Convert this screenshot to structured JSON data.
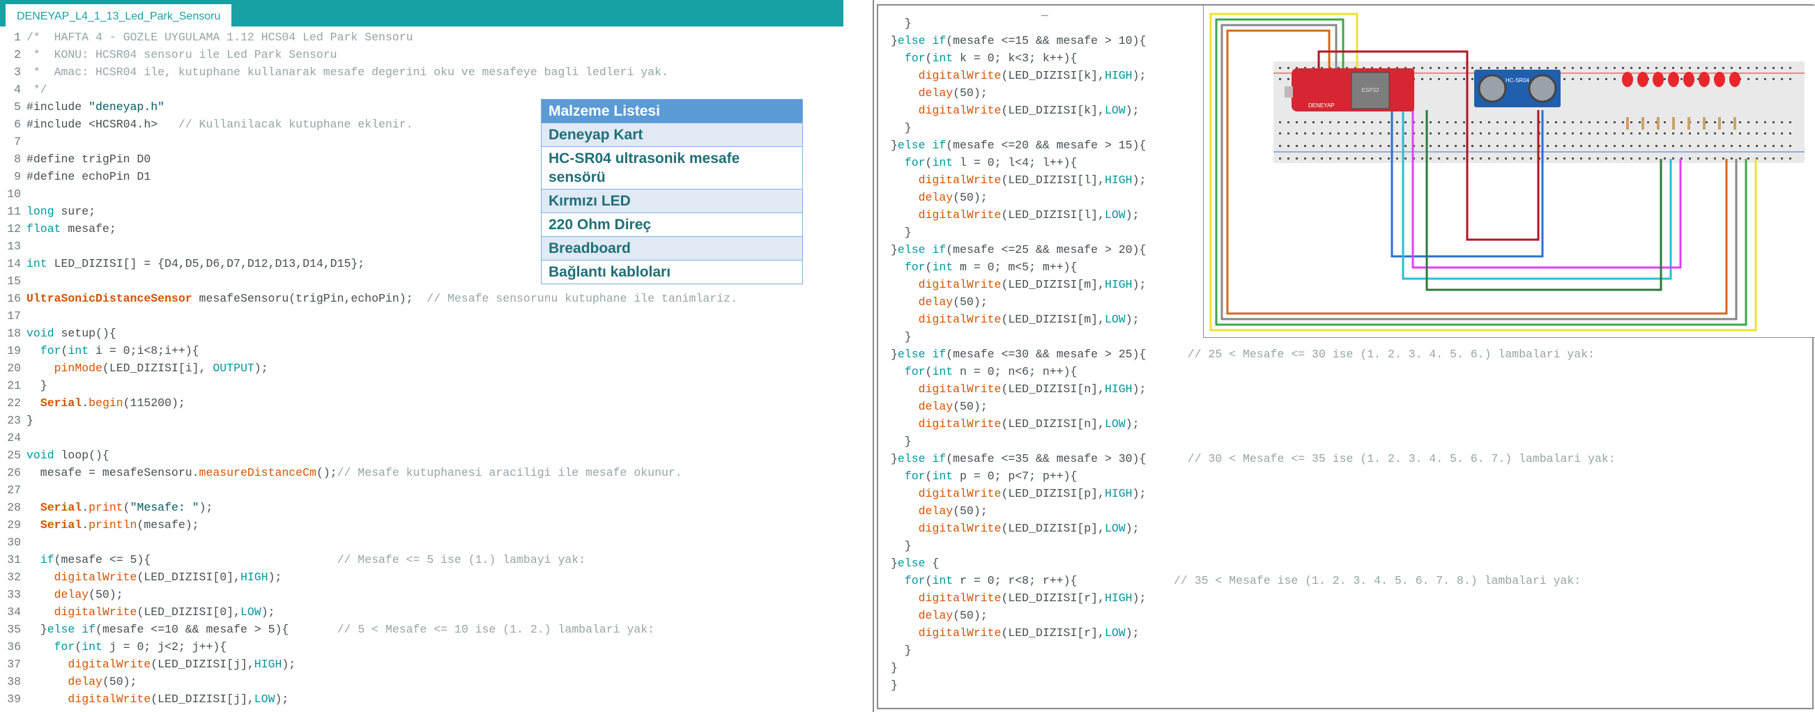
{
  "editor": {
    "tab_title": "DENEYAP_L4_1_13_Led_Park_Sensoru"
  },
  "materials": {
    "title": "Malzeme Listesi",
    "items": [
      "Deneyap Kart",
      "HC-SR04 ultrasonik mesafe sensörü",
      "Kırmızı LED",
      "220 Ohm Direç",
      "Breadboard",
      "Bağlantı kabloları"
    ]
  },
  "diagram": {
    "board_brand": "DENEYAP",
    "chip_label": "ESP32",
    "sensor_label": "HC-SR04",
    "led_count": 8,
    "colors": {
      "breadboard": "#e9e9e9",
      "board": "#d72631",
      "sensor": "#1f5fae",
      "led": "#e8262c"
    },
    "wire_colors": [
      "#f0e130",
      "#3aa84a",
      "#888888",
      "#d2691e",
      "#b0171f",
      "#2b6fd6",
      "#2bbcd4",
      "#e040fb",
      "#2b7a3a"
    ]
  },
  "code_left": [
    "/*  HAFTA 4 - GOZLE UYGULAMA 1.12 HCS04 Led Park Sensoru",
    " *  KONU: HCSR04 sensoru ile Led Park Sensoru",
    " *  Amac: HCSR04 ile, kutuphane kullanarak mesafe degerini oku ve mesafeye bagli ledleri yak.",
    " */",
    "#include \"deneyap.h\"",
    "#include <HCSR04.h>   // Kullanilacak kutuphane eklenir.",
    "",
    "#define trigPin D0",
    "#define echoPin D1",
    "",
    "long sure;",
    "float mesafe;",
    "",
    "int LED_DIZISI[] = {D4,D5,D6,D7,D12,D13,D14,D15};",
    "",
    "UltraSonicDistanceSensor mesafeSensoru(trigPin,echoPin);  // Mesafe sensorunu kutuphane ile tanimlariz.",
    "",
    "void setup(){",
    "  for(int i = 0;i<8;i++){",
    "    pinMode(LED_DIZISI[i], OUTPUT);",
    "  }",
    "  Serial.begin(115200);",
    "}",
    "",
    "void loop(){",
    "  mesafe = mesafeSensoru.measureDistanceCm();// Mesafe kutuphanesi araciligi ile mesafe okunur.",
    "",
    "  Serial.print(\"Mesafe: \");",
    "  Serial.println(mesafe);",
    "",
    "  if(mesafe <= 5){                           // Mesafe <= 5 ise (1.) lambayi yak:",
    "    digitalWrite(LED_DIZISI[0],HIGH);",
    "    delay(50);",
    "    digitalWrite(LED_DIZISI[0],LOW);",
    "  }else if(mesafe <=10 && mesafe > 5){       // 5 < Mesafe <= 10 ise (1. 2.) lambalari yak:",
    "    for(int j = 0; j<2; j++){",
    "      digitalWrite(LED_DIZISI[j],HIGH);",
    "      delay(50);",
    "      digitalWrite(LED_DIZISI[j],LOW);"
  ],
  "code_right": [
    "  }",
    "}else if(mesafe <=15 && mesafe > 10){",
    "  for(int k = 0; k<3; k++){",
    "    digitalWrite(LED_DIZISI[k],HIGH);",
    "    delay(50);",
    "    digitalWrite(LED_DIZISI[k],LOW);",
    "  }",
    "}else if(mesafe <=20 && mesafe > 15){",
    "  for(int l = 0; l<4; l++){",
    "    digitalWrite(LED_DIZISI[l],HIGH);",
    "    delay(50);",
    "    digitalWrite(LED_DIZISI[l],LOW);",
    "  }",
    "}else if(mesafe <=25 && mesafe > 20){",
    "  for(int m = 0; m<5; m++){",
    "    digitalWrite(LED_DIZISI[m],HIGH);",
    "    delay(50);",
    "    digitalWrite(LED_DIZISI[m],LOW);",
    "  }",
    "}else if(mesafe <=30 && mesafe > 25){      // 25 < Mesafe <= 30 ise (1. 2. 3. 4. 5. 6.) lambalari yak:",
    "  for(int n = 0; n<6; n++){",
    "    digitalWrite(LED_DIZISI[n],HIGH);",
    "    delay(50);",
    "    digitalWrite(LED_DIZISI[n],LOW);",
    "  }",
    "}else if(mesafe <=35 && mesafe > 30){      // 30 < Mesafe <= 35 ise (1. 2. 3. 4. 5. 6. 7.) lambalari yak:",
    "  for(int p = 0; p<7; p++){",
    "    digitalWrite(LED_DIZISI[p],HIGH);",
    "    delay(50);",
    "    digitalWrite(LED_DIZISI[p],LOW);",
    "  }",
    "}else {",
    "  for(int r = 0; r<8; r++){              // 35 < Mesafe ise (1. 2. 3. 4. 5. 6. 7. 8.) lambalari yak:",
    "    digitalWrite(LED_DIZISI[r],HIGH);",
    "    delay(50);",
    "    digitalWrite(LED_DIZISI[r],LOW);",
    "  }",
    "}",
    "}"
  ]
}
